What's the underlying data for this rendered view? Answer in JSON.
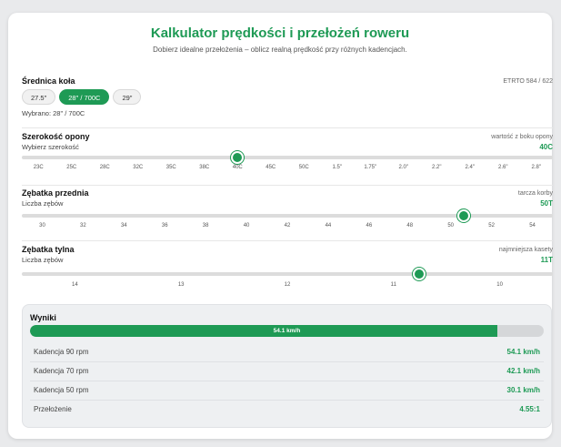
{
  "header": {
    "title": "Kalkulator prędkości i przełożeń roweru",
    "subtitle": "Dobierz idealne przełożenia – oblicz realną prędkość przy różnych kadencjach."
  },
  "wheel": {
    "heading": "Średnica koła",
    "note": "ETRTO 584 / 622",
    "options": [
      "27.5\"",
      "28\" / 700C",
      "29\""
    ],
    "selected_index": 1,
    "selected_text": "Wybrano: 28\" / 700C"
  },
  "tire": {
    "heading": "Szerokość opony",
    "note": "wartość z boku opony",
    "label": "Wybierz szerokość",
    "value": "40C",
    "selected_index": 6,
    "ticks": [
      "23C",
      "25C",
      "28C",
      "32C",
      "35C",
      "38C",
      "40C",
      "45C",
      "50C",
      "1.5\"",
      "1.75\"",
      "2.0\"",
      "2.2\"",
      "2.4\"",
      "2.6\"",
      "2.8\""
    ]
  },
  "front": {
    "heading": "Zębatka przednia",
    "note": "tarcza korby",
    "label": "Liczba zębów",
    "value": "50T",
    "fraction": 0.833,
    "ticks": [
      "30",
      "32",
      "34",
      "36",
      "38",
      "40",
      "42",
      "44",
      "46",
      "48",
      "50",
      "52",
      "54"
    ]
  },
  "rear": {
    "heading": "Zębatka tylna",
    "note": "najmniejsza kasety",
    "label": "Liczba zębów",
    "value": "11T",
    "fraction": 0.748,
    "ticks": [
      "14",
      "13",
      "12",
      "11",
      "10"
    ]
  },
  "results": {
    "title": "Wyniki",
    "bar_text": "54.1 km/h",
    "bar_fraction": 0.91,
    "rows": [
      {
        "label": "Kadencja 90 rpm",
        "value": "54.1 km/h"
      },
      {
        "label": "Kadencja 70 rpm",
        "value": "42.1 km/h"
      },
      {
        "label": "Kadencja 50 rpm",
        "value": "30.1 km/h"
      },
      {
        "label": "Przełożenie",
        "value": "4.55:1"
      }
    ]
  },
  "colors": {
    "accent": "#1e9a55",
    "track": "#dcdcdc",
    "panel": "#eef0f2"
  }
}
